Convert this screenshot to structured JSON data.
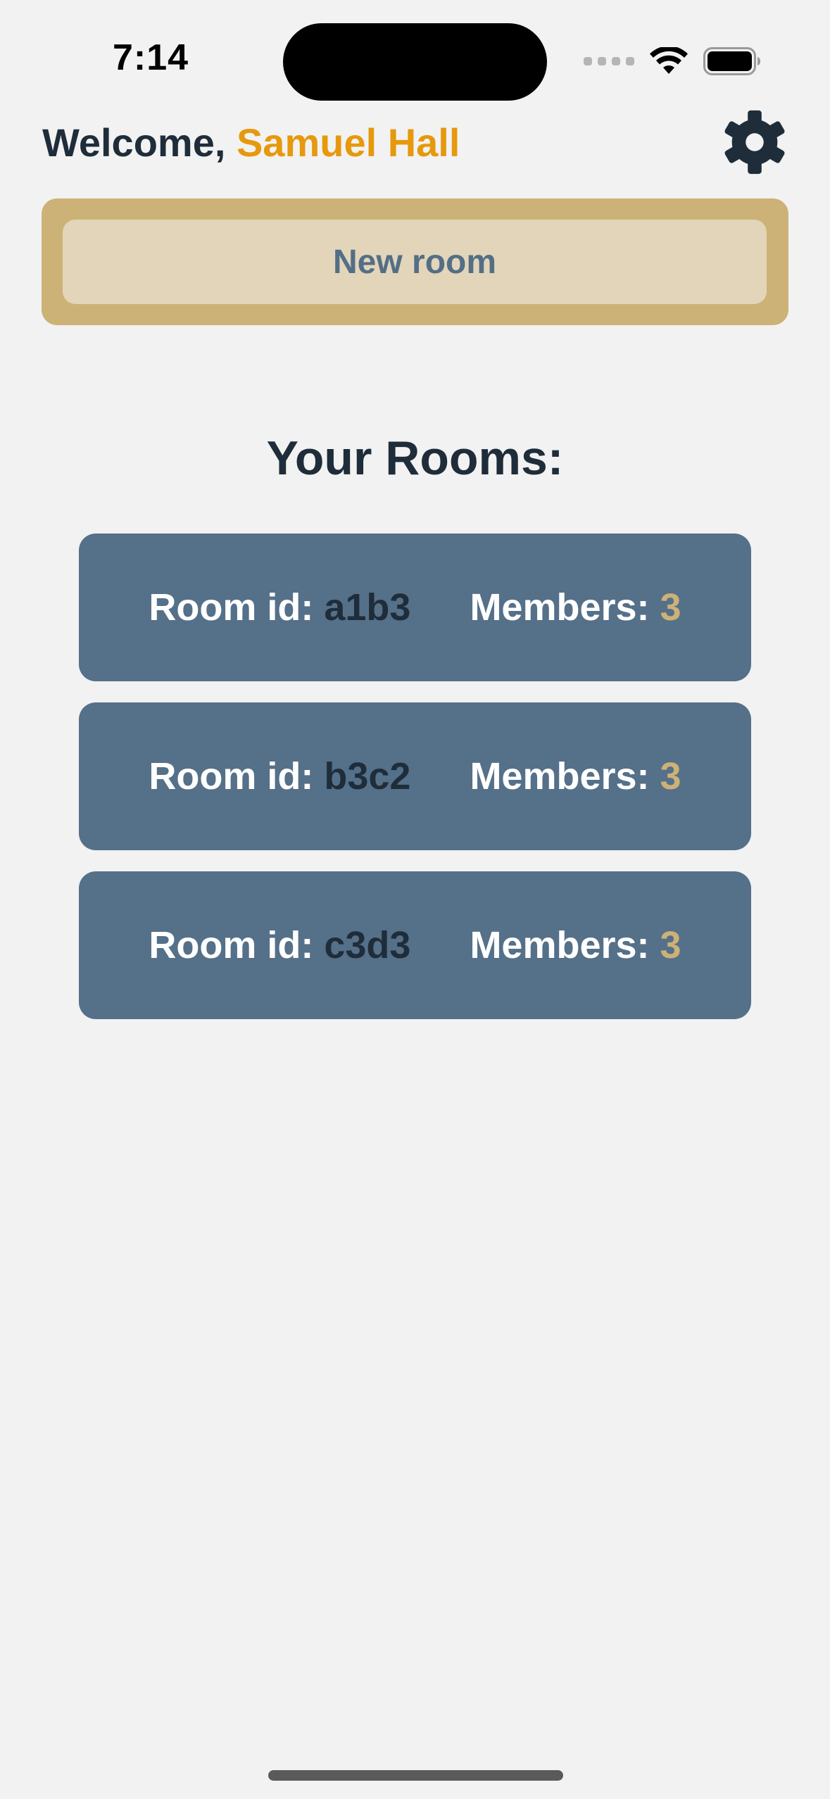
{
  "status_bar": {
    "time": "7:14",
    "icons": [
      "cellular-signal-icon",
      "wifi-icon",
      "battery-icon"
    ]
  },
  "header": {
    "welcome_prefix": "Welcome, ",
    "user_name": "Samuel Hall",
    "settings_icon": "gear-icon"
  },
  "new_room": {
    "label": "New room"
  },
  "rooms_section": {
    "title": "Your Rooms:",
    "room_id_label": "Room id: ",
    "members_label": "Members: ",
    "rooms": [
      {
        "id": "a1b3",
        "members": "3"
      },
      {
        "id": "b3c2",
        "members": "3"
      },
      {
        "id": "c3d3",
        "members": "3"
      }
    ]
  },
  "colors": {
    "background": "#f2f2f2",
    "text_dark": "#1f2d3a",
    "accent_orange": "#e6990d",
    "gold": "#ccb277",
    "button_light": "#e2d5b9",
    "card_blue": "#557089"
  }
}
